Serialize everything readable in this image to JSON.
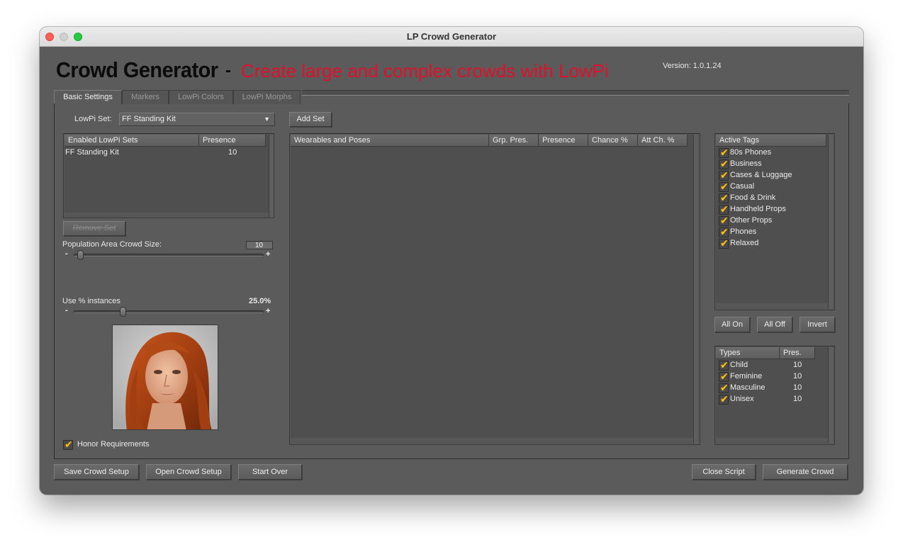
{
  "window": {
    "title": "LP Crowd Generator"
  },
  "header": {
    "title": "Crowd Generator",
    "separator": "-",
    "subtitle": "Create large and complex crowds with LowPi",
    "version": "Version: 1.0.1.24"
  },
  "tabs": [
    "Basic Settings",
    "Markers",
    "LowPi Colors",
    "LowPi Morphs"
  ],
  "lowpi_set": {
    "label": "LowPi Set:",
    "selected": "FF Standing Kit",
    "add_button": "Add Set"
  },
  "enabled_sets": {
    "columns": [
      "Enabled LowPi Sets",
      "Presence"
    ],
    "rows": [
      {
        "name": "FF Standing Kit",
        "presence": "10"
      }
    ],
    "remove_button": "Remove Set"
  },
  "crowd_size": {
    "label": "Population Area Crowd Size:",
    "value": "10",
    "min_label": "-",
    "max_label": "+",
    "fraction": 0.02
  },
  "instances": {
    "label": "Use % instances",
    "value": "25.0%",
    "min_label": "-",
    "max_label": "+",
    "fraction": 0.25
  },
  "honor_requirements": {
    "label": "Honor Requirements",
    "checked": true
  },
  "wearables": {
    "columns": [
      "Wearables and Poses",
      "Grp. Pres.",
      "Presence",
      "Chance %",
      "Att Ch. %"
    ],
    "rows": []
  },
  "active_tags": {
    "column": "Active Tags",
    "items": [
      "80s Phones",
      "Business",
      "Cases & Luggage",
      "Casual",
      "Food & Drink",
      "Handheld Props",
      "Other Props",
      "Phones",
      "Relaxed"
    ],
    "buttons": [
      "All On",
      "All Off",
      "Invert"
    ]
  },
  "types": {
    "columns": [
      "Types",
      "Pres."
    ],
    "rows": [
      {
        "name": "Child",
        "pres": "10"
      },
      {
        "name": "Feminine",
        "pres": "10"
      },
      {
        "name": "Masculine",
        "pres": "10"
      },
      {
        "name": "Unisex",
        "pres": "10"
      }
    ]
  },
  "footer": {
    "save": "Save Crowd Setup",
    "open": "Open Crowd Setup",
    "start_over": "Start Over",
    "close": "Close Script",
    "generate": "Generate Crowd"
  },
  "colors": {
    "accent": "#e0102b",
    "check": "#ffc21a",
    "panel": "#5b5b5b"
  }
}
